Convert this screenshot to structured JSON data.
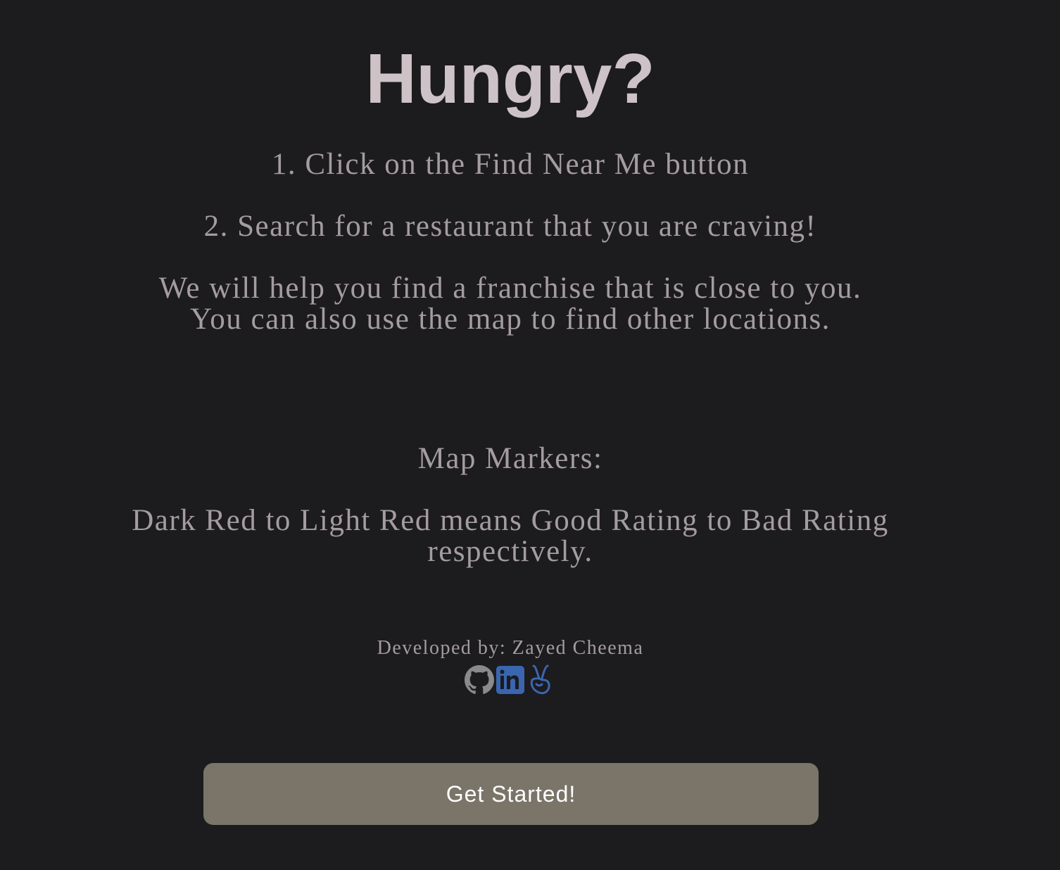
{
  "title": "Hungry?",
  "instructions": {
    "step1": "1. Click on the Find Near Me button",
    "step2": "2. Search for a restaurant that you are craving!",
    "info_line1": "We will help you find a franchise that is close to you.",
    "info_line2": "You can also use the map to find other locations."
  },
  "markers": {
    "heading": "Map Markers:",
    "line1": "Dark Red to Light Red means Good Rating to Bad Rating",
    "line2": "respectively."
  },
  "footer": {
    "developer": "Developed by: Zayed Cheema",
    "socials": [
      {
        "icon": "github-icon",
        "color": "#8a8a8a"
      },
      {
        "icon": "linkedin-icon",
        "color": "#3a66b0"
      },
      {
        "icon": "angellist-icon",
        "color": "#3a66b0"
      }
    ]
  },
  "cta": {
    "label": "Get Started!"
  },
  "colors": {
    "background": "#1c1b1e",
    "title": "#cdc2c6",
    "body_text": "#a49ca0",
    "button": "#7a7469",
    "button_text": "#ffffff"
  }
}
